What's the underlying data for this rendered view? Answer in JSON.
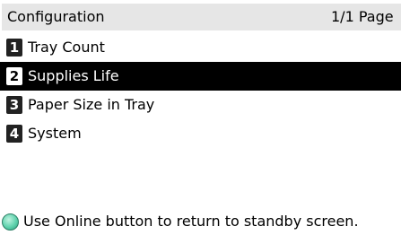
{
  "header": {
    "title": "Configuration",
    "page": "1/1 Page"
  },
  "menu": {
    "items": [
      {
        "number": "1",
        "label": "Tray Count",
        "selected": false
      },
      {
        "number": "2",
        "label": "Supplies Life",
        "selected": true
      },
      {
        "number": "3",
        "label": "Paper Size in Tray",
        "selected": false
      },
      {
        "number": "4",
        "label": "System",
        "selected": false
      }
    ]
  },
  "footer": {
    "icon": "online-button-icon",
    "message": "Use Online button to return to standby screen."
  },
  "colors": {
    "header_bg": "#e6e6e6",
    "selected_bg": "#000000",
    "selected_fg": "#ffffff",
    "online_icon": "#5fd2ad"
  }
}
